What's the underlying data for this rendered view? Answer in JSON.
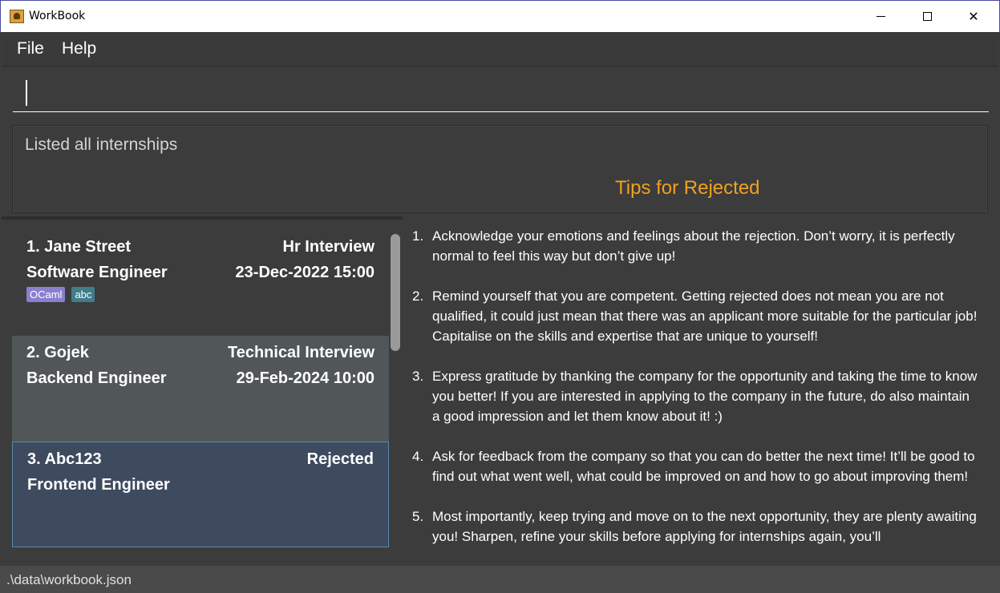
{
  "window": {
    "title": "WorkBook",
    "controls": {
      "minimize": "",
      "maximize": "",
      "close": "✕"
    }
  },
  "menu": {
    "items": [
      {
        "label": "File"
      },
      {
        "label": "Help"
      }
    ]
  },
  "command": {
    "value": "",
    "placeholder": ""
  },
  "result": {
    "message": "Listed all internships"
  },
  "tips": {
    "title": "Tips for Rejected",
    "items": [
      {
        "num": "1.",
        "text": "Acknowledge your emotions and feelings about the rejection. Don’t worry, it is perfectly normal to feel this way but don’t give up!"
      },
      {
        "num": "2.",
        "text": "Remind yourself that you are competent. Getting rejected does not mean you are not qualified, it could just mean that there was an applicant more suitable for the particular job! Capitalise on the skills and expertise that are unique to yourself!"
      },
      {
        "num": "3.",
        "text": "Express gratitude by thanking the company for the opportunity and taking the time to know you better! If you are interested in applying to the company in the future, do also maintain a good impression and let them know about it! :)"
      },
      {
        "num": "4.",
        "text": "Ask for feedback from the company so that you can do better the next time! It’ll be good to find out what went well, what could be improved on and how to go about improving them!"
      },
      {
        "num": "5.",
        "text": "Most importantly, keep trying and move on to the next opportunity, they are plenty awaiting you! Sharpen, refine your skills before applying for internships again, you’ll"
      }
    ]
  },
  "internships": [
    {
      "index_name": "1.   Jane Street",
      "stage": "Hr Interview",
      "role": "Software Engineer",
      "date": "23-Dec-2022 15:00",
      "tags": [
        {
          "label": "OCaml",
          "color": "#8a7fd0"
        },
        {
          "label": "abc",
          "color": "#3f7d8a"
        }
      ]
    },
    {
      "index_name": "2.   Gojek",
      "stage": "Technical Interview",
      "role": "Backend Engineer",
      "date": "29-Feb-2024 10:00",
      "tags": []
    },
    {
      "index_name": "3.   Abc123",
      "stage": "Rejected",
      "role": "Frontend Engineer",
      "date": "",
      "tags": []
    }
  ],
  "status": {
    "path": ".\\data\\workbook.json"
  },
  "colors": {
    "background": "#3c3c3c",
    "accent_title": "#f0a020",
    "selected_card": "#3e4a5e",
    "hover_card": "#515658"
  }
}
